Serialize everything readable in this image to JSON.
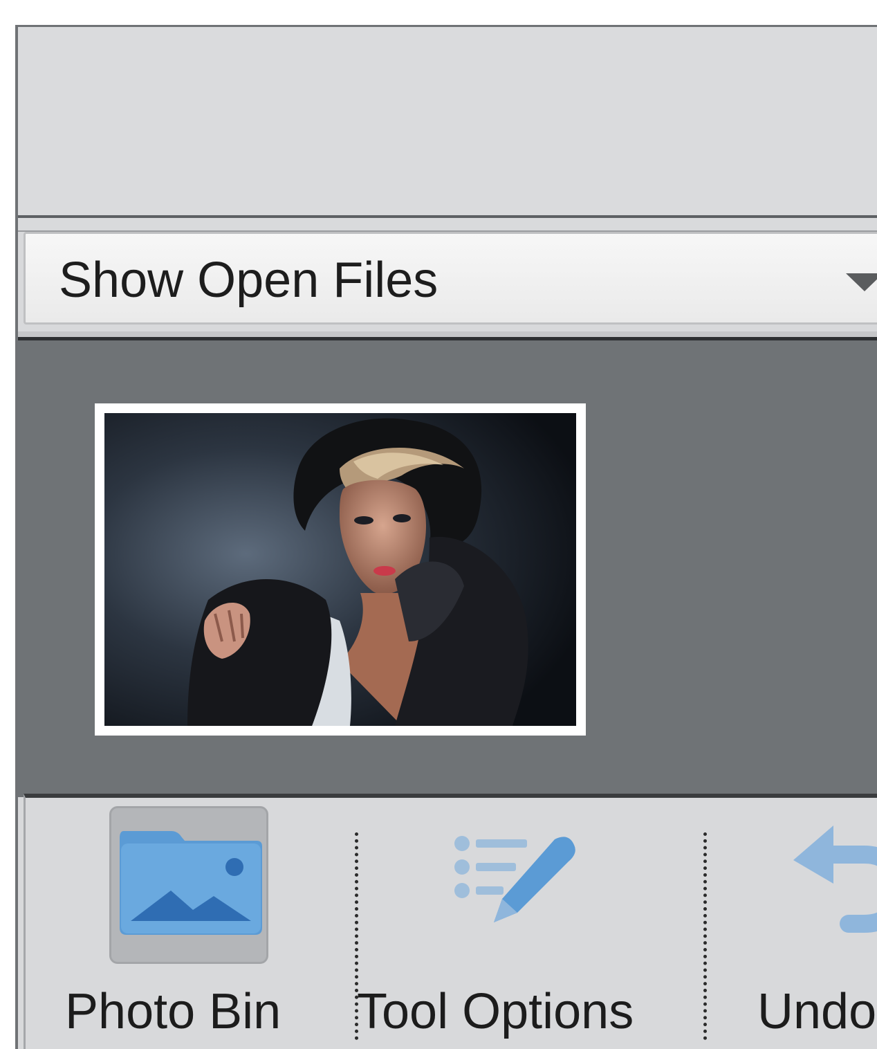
{
  "dropdown": {
    "label": "Show Open Files"
  },
  "toolbar": {
    "photo_bin_label": "Photo Bin",
    "tool_options_label": "Tool Options",
    "undo_label": "Undo"
  },
  "icons": {
    "dropdown_arrow": "chevron-down-icon",
    "photo_bin": "photo-folder-icon",
    "tool_options": "list-pencil-icon",
    "undo": "undo-arrow-icon"
  },
  "colors": {
    "icon_blue": "#5b9bd5",
    "icon_blue_dark": "#2f6db3",
    "bin_background": "#6f7376",
    "toolbar_background": "#d8d9db"
  }
}
